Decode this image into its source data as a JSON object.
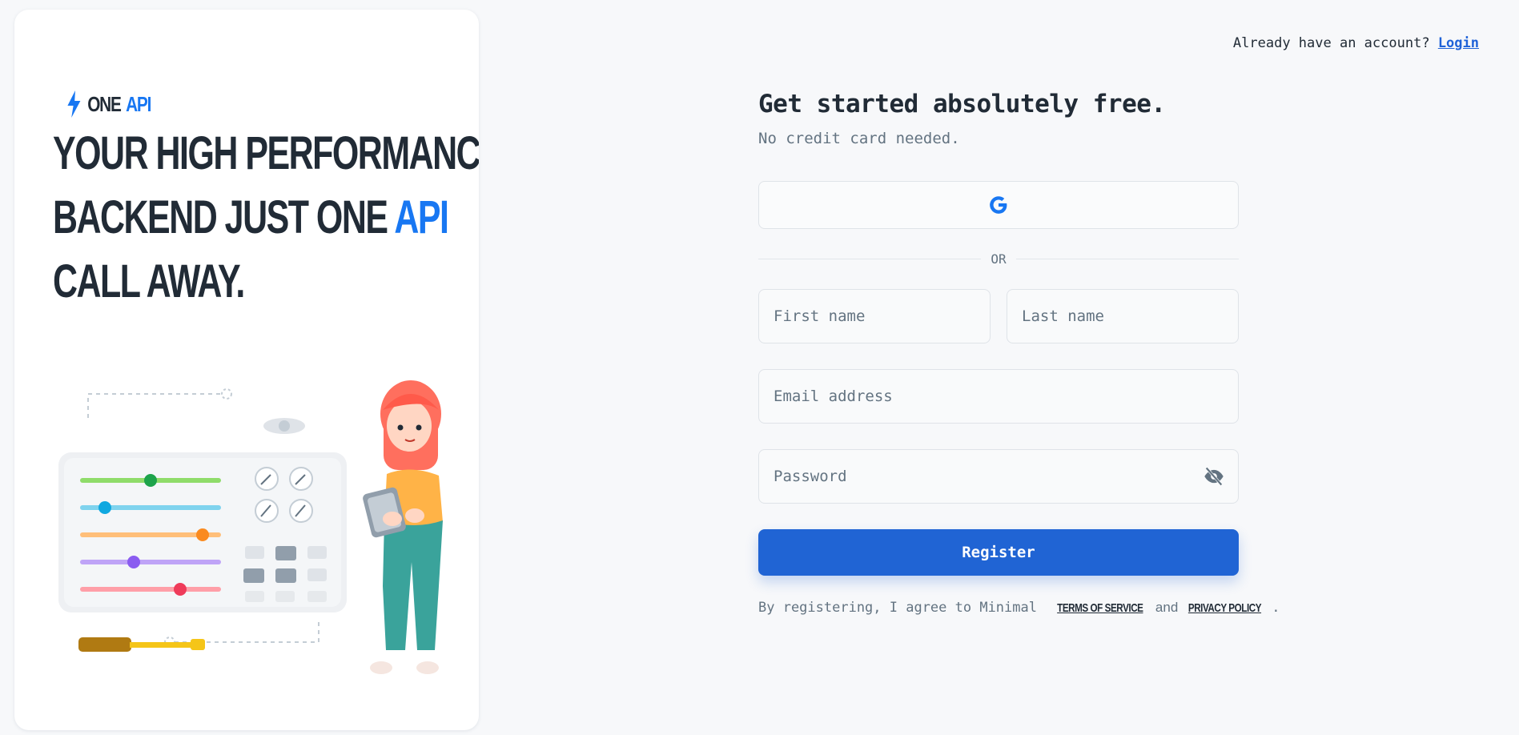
{
  "brand": {
    "part1": "ONE",
    "part2": "API"
  },
  "hero": {
    "line1": "YOUR HIGH PERFORMANCE",
    "line2_prefix": "BACKEND JUST ONE",
    "line2_accent": "API",
    "line3": "CALL AWAY."
  },
  "header": {
    "login_prompt": "Already have an account?",
    "login_link": "Login"
  },
  "form": {
    "title": "Get started absolutely free.",
    "subtitle": "No credit card needed.",
    "social_icon": "google-icon",
    "divider": "OR",
    "first_name_placeholder": "First name",
    "last_name_placeholder": "Last name",
    "email_placeholder": "Email address",
    "password_placeholder": "Password",
    "password_toggle_icon": "eye-off-icon",
    "register_label": "Register"
  },
  "terms": {
    "prefix": "By registering, I agree to Minimal",
    "tos": "Terms of Service",
    "and": "and",
    "privacy": "Privacy Policy",
    "suffix": "."
  },
  "colors": {
    "accent": "#1877f2",
    "button": "#2064d4",
    "text": "#212b36",
    "muted": "#637381"
  }
}
